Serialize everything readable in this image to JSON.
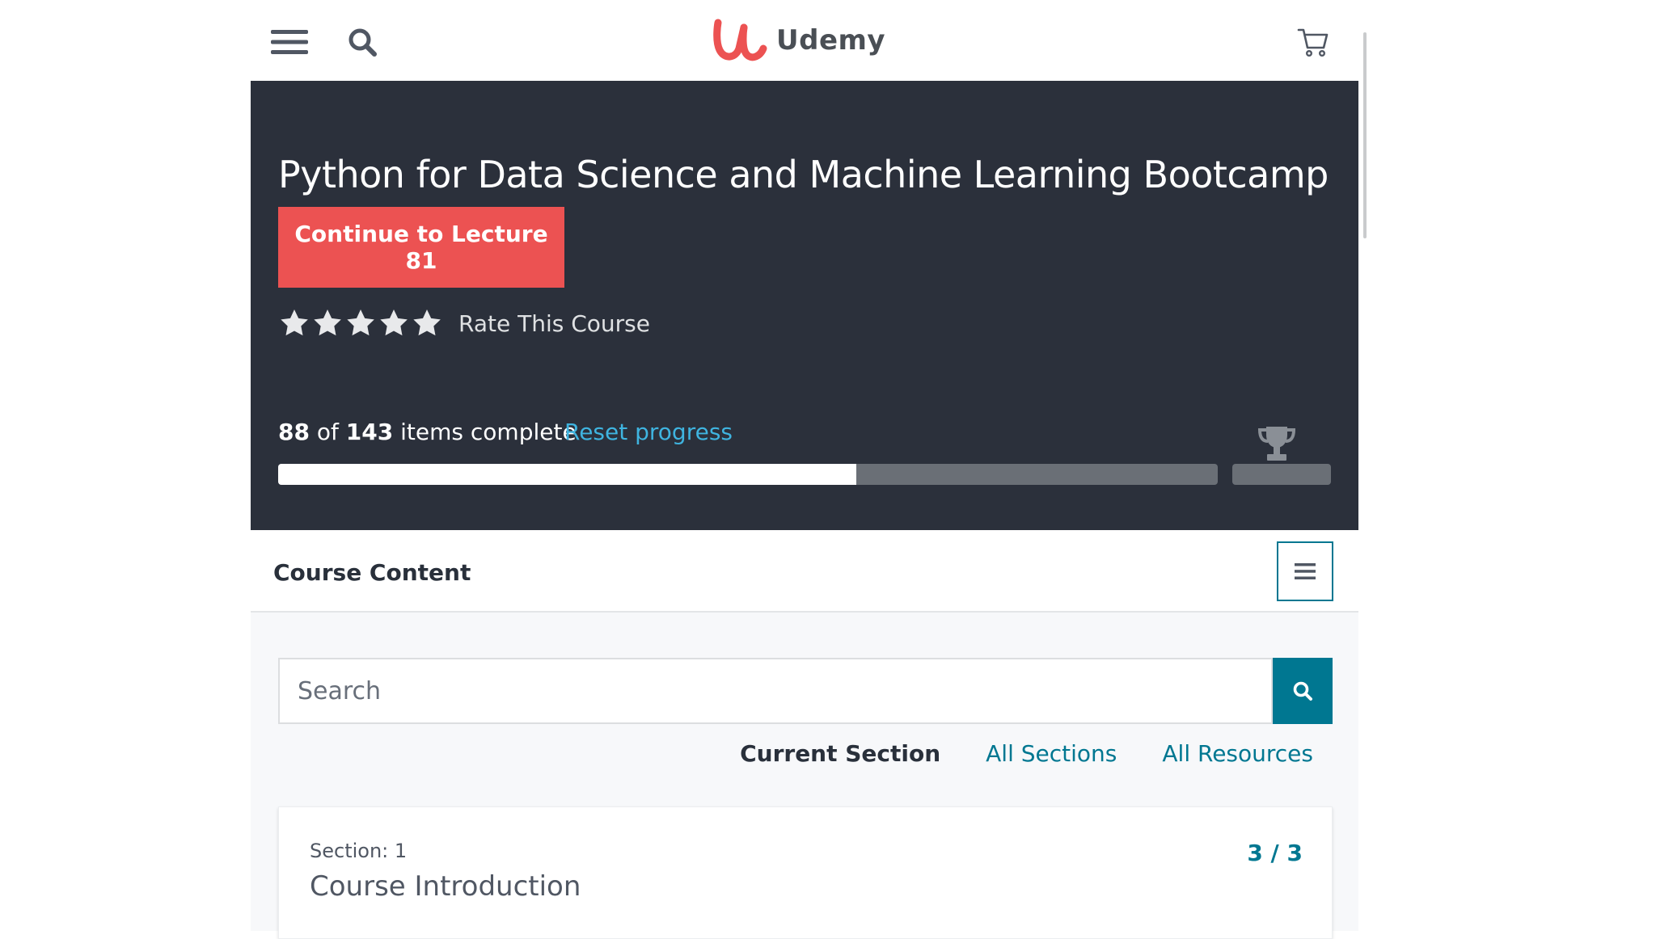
{
  "brand": {
    "name": "Udemy",
    "logo_color": "#ec5252"
  },
  "topbar": {
    "menu_icon": "hamburger-icon",
    "search_icon": "search-icon",
    "cart_icon": "cart-icon"
  },
  "course": {
    "title": "Python for Data Science and Machine Learning Bootcamp",
    "continue_label": "Continue to Lecture 81",
    "rating": {
      "stars": 5,
      "label": "Rate This Course"
    },
    "progress": {
      "completed": "88",
      "of_word": "of",
      "total": "143",
      "suffix": "items complete",
      "fraction": 0.615,
      "reset_label": "Reset progress"
    }
  },
  "course_content": {
    "title": "Course Content",
    "search": {
      "placeholder": "Search",
      "value": ""
    },
    "filters": [
      {
        "label": "Current Section",
        "active": true
      },
      {
        "label": "All Sections",
        "active": false
      },
      {
        "label": "All Resources",
        "active": false
      }
    ],
    "sections": [
      {
        "number_label": "Section: 1",
        "title": "Course Introduction",
        "count": "3 / 3"
      }
    ]
  },
  "colors": {
    "hero_bg": "#2b303b",
    "accent": "#ec5252",
    "link": "#007791",
    "reset_link": "#3fb4e0"
  }
}
